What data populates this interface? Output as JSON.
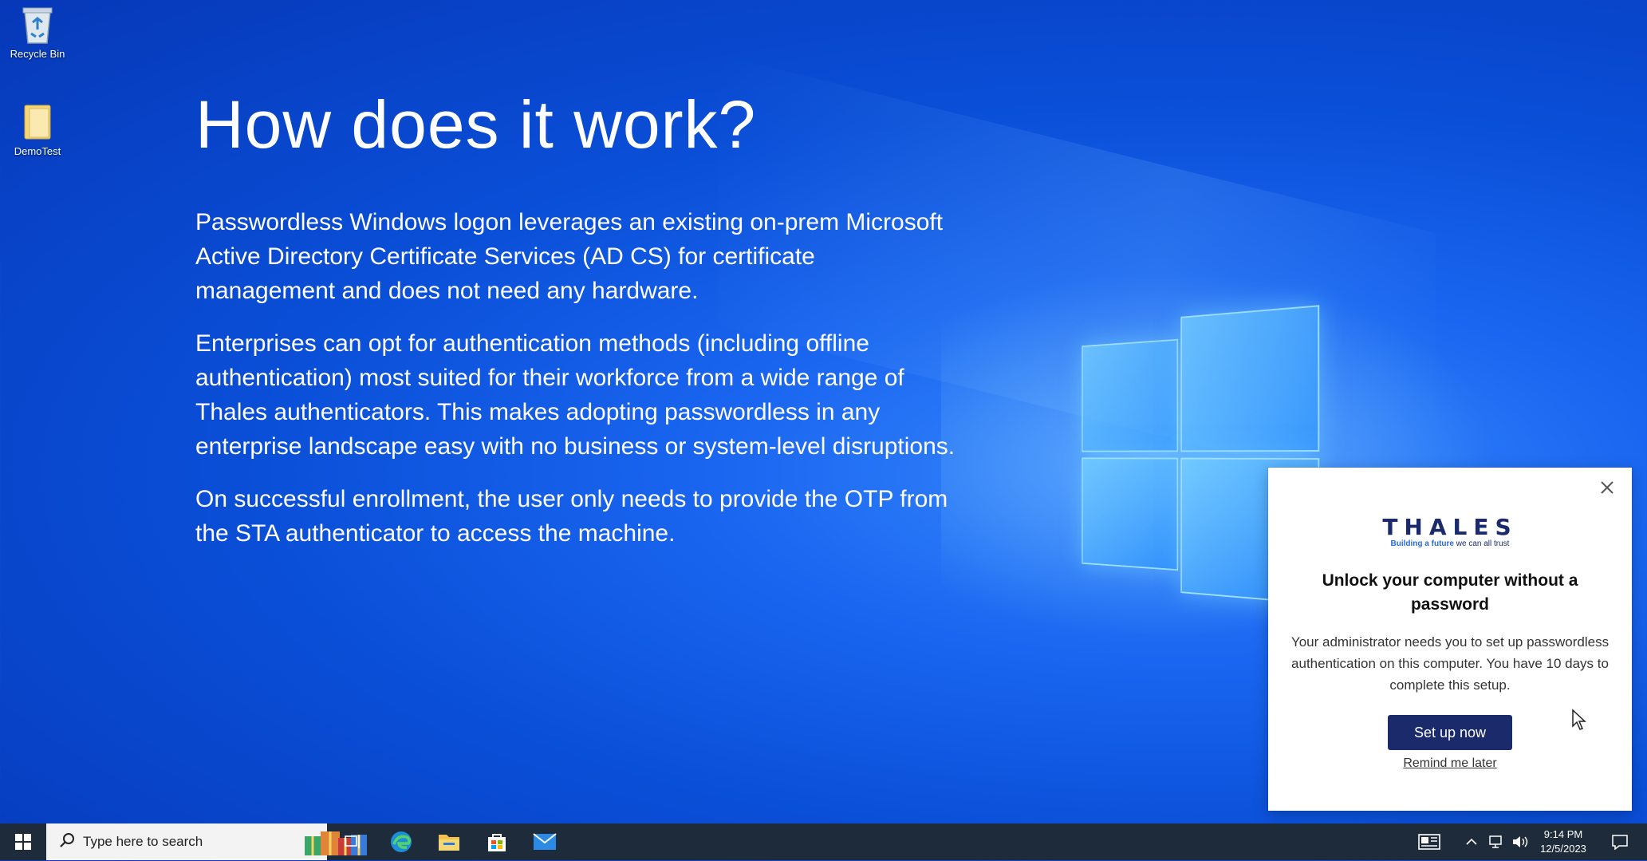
{
  "desktop": {
    "icons": [
      {
        "label": "Recycle Bin",
        "icon": "recycle-bin-icon"
      },
      {
        "label": "DemoTest",
        "icon": "folder-icon"
      }
    ]
  },
  "content": {
    "heading": "How does it work?",
    "paragraphs": [
      "Passwordless Windows logon leverages an existing on-prem Microsoft Active Directory Certificate Services (AD CS) for certificate management and does not need any hardware.",
      "Enterprises can opt for authentication methods (including offline authentication) most suited for their workforce from a wide range of Thales authenticators. This makes adopting passwordless in any enterprise landscape easy with no business or system-level disruptions.",
      "On successful enrollment, the user only needs to provide the OTP from the STA authenticator to access the machine."
    ]
  },
  "popup": {
    "logo_text": "THALES",
    "tagline_emphasis": "Building a future",
    "tagline_rest": " we can all trust",
    "title": "Unlock your computer without a password",
    "body": "Your administrator needs you to set up passwordless authentication on this computer. You have 10 days to complete this setup.",
    "primary_button": "Set up now",
    "secondary_link": "Remind me later",
    "brand_color": "#1b2a6b"
  },
  "taskbar": {
    "search_placeholder": "Type here to search",
    "pinned": [
      "task-view-icon",
      "edge-icon",
      "file-explorer-icon",
      "store-icon",
      "mail-icon"
    ],
    "time": "9:14 PM",
    "date": "12/5/2023",
    "background_color": "#1e2b3a"
  }
}
